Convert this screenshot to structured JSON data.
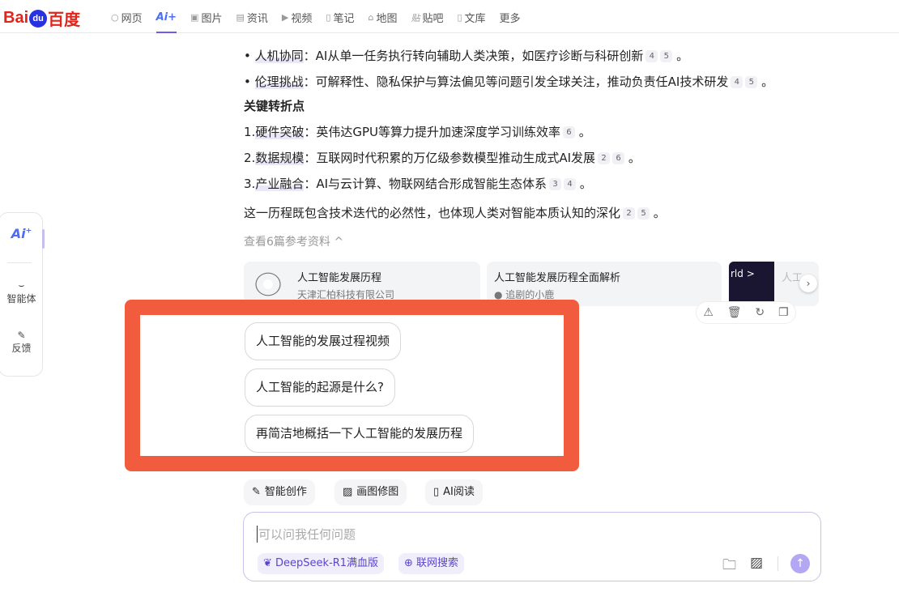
{
  "header": {
    "logo": "Bai du 百度",
    "nav": [
      "网页",
      "Ai+",
      "图片",
      "资讯",
      "视频",
      "笔记",
      "地图",
      "贴吧",
      "文库",
      "更多"
    ],
    "active": "Ai+"
  },
  "content": {
    "bullets": [
      {
        "term": "人机协同",
        "text": "：AI从单一任务执行转向辅助人类决策，如医疗诊断与科研创新",
        "cites": [
          "4",
          "5"
        ]
      },
      {
        "term": "伦理挑战",
        "text": "：可解释性、隐私保护与算法偏见等问题引发全球关注，推动负责任AI技术研发",
        "cites": [
          "4",
          "5"
        ]
      }
    ],
    "heading": "关键转折点",
    "points": [
      {
        "num": "1.",
        "term": "硬件突破",
        "text": "：英伟达GPU等算力提升加速深度学习训练效率",
        "cites": [
          "6"
        ]
      },
      {
        "num": "2.",
        "term": "数据规模",
        "text": "：互联网时代积累的万亿级参数模型推动生成式AI发展",
        "cites": [
          "2",
          "6"
        ]
      },
      {
        "num": "3.",
        "term": "产业融合",
        "text": "：AI与云计算、物联网结合形成智能生态体系",
        "cites": [
          "3",
          "4"
        ]
      }
    ],
    "summary": {
      "text": "这一历程既包含技术迭代的必然性，也体现人类对智能本质认知的深化",
      "cites": [
        "2",
        "5"
      ]
    },
    "period": "。",
    "refs_toggle": "查看6篇参考资料 ^"
  },
  "refs": [
    {
      "title": "人工智能发展历程",
      "source": "天津汇柏科技有限公司"
    },
    {
      "title": "人工智能发展历程全面解析",
      "source": "追剧的小鹿"
    },
    {
      "title": "人工",
      "thumb_text": "rld >"
    }
  ],
  "suggestions": [
    "人工智能的发展过程视频",
    "人工智能的起源是什么?",
    "再简洁地概括一下人工智能的发展历程"
  ],
  "tools": [
    "智能创作",
    "画图修图",
    "AI阅读"
  ],
  "input": {
    "placeholder": "可以问我任何问题",
    "model": "DeepSeek-R1满血版",
    "web_search": "联网搜索"
  },
  "sidebar": {
    "ai": "Ai",
    "agent": "智能体",
    "feedback": "反馈"
  },
  "colors": {
    "highlight": "#f25c3e",
    "accent": "#6c5ce7",
    "baidu_red": "#e1251b"
  }
}
